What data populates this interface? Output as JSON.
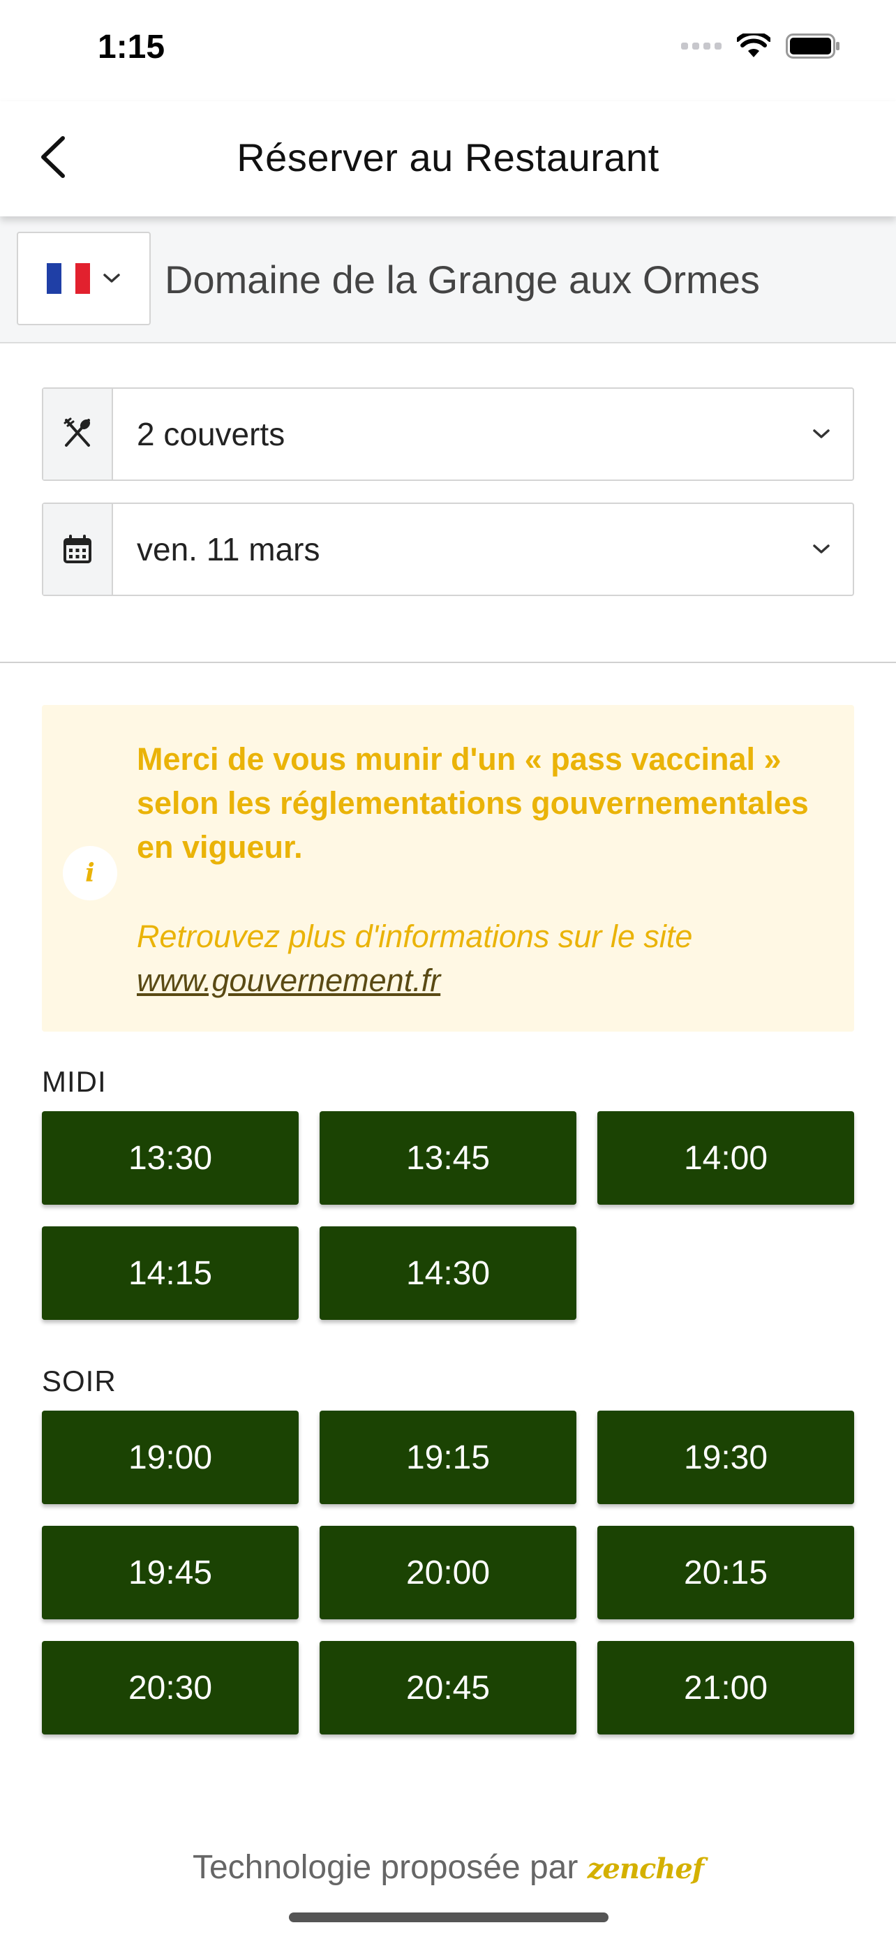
{
  "status_bar": {
    "time": "1:15"
  },
  "header": {
    "title": "Réserver au Restaurant"
  },
  "restaurant": {
    "name": "Domaine de la Grange aux Ormes",
    "flag_colors": [
      "#1f3fa6",
      "#ffffff",
      "#e2212e"
    ]
  },
  "selects": {
    "guests": {
      "value": "2 couverts",
      "icon": "utensils-icon"
    },
    "date": {
      "value": "ven. 11 mars",
      "icon": "calendar-icon"
    }
  },
  "notice": {
    "main": "Merci de vous munir d'un « pass vaccinal » selon les réglementations gouvernementales en vigueur.",
    "sub": "Retrouvez plus d'informations sur le site",
    "link": "www.gouvernement.fr",
    "icon_text": "i"
  },
  "midi": {
    "label": "MIDI",
    "slots": [
      "13:30",
      "13:45",
      "14:00",
      "14:15",
      "14:30"
    ]
  },
  "soir": {
    "label": "SOIR",
    "slots": [
      "19:00",
      "19:15",
      "19:30",
      "19:45",
      "20:00",
      "20:15",
      "20:30",
      "20:45",
      "21:00"
    ]
  },
  "footer": {
    "text": "Technologie proposée par",
    "brand": "zenchef"
  },
  "colors": {
    "accent": "#1b4303",
    "notice_bg": "#fff8e4",
    "notice_text": "#eab308"
  }
}
